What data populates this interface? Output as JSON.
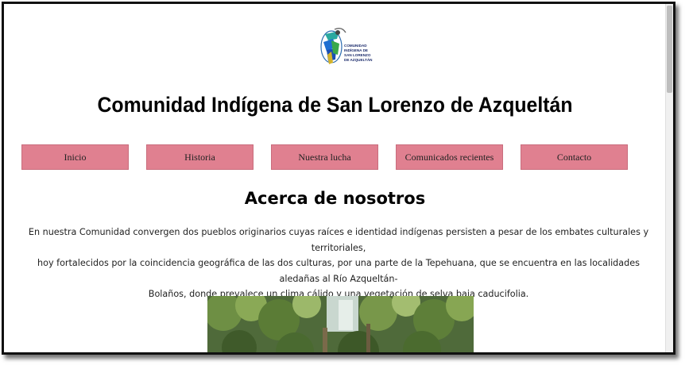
{
  "logo": {
    "alt_text_lines": [
      "COMUNIDAD",
      "INDÍGENA DE",
      "SAN LORENZO",
      "DE AZQUELTÁN"
    ]
  },
  "header": {
    "title": "Comunidad Indígena de San Lorenzo de Azqueltán"
  },
  "nav": {
    "items": [
      {
        "label": "Inicio"
      },
      {
        "label": "Historia"
      },
      {
        "label": "Nuestra lucha"
      },
      {
        "label": "Comunicados recientes"
      },
      {
        "label": "Contacto"
      }
    ],
    "button_color": "#e08090"
  },
  "about": {
    "heading": "Acerca de nosotros",
    "lines": [
      "En nuestra Comunidad convergen dos pueblos originarios cuyas raíces e identidad indígenas persisten a pesar de los embates culturales y territoriales,",
      "hoy fortalecidos por la coincidencia geográfica de las dos culturas, por una parte de la Tepehuana, que se encuentra en las localidades aledañas al Río Azqueltán-",
      "Bolaños, donde prevalece un clima cálido y una vegetación de selva baja caducifolia."
    ]
  }
}
